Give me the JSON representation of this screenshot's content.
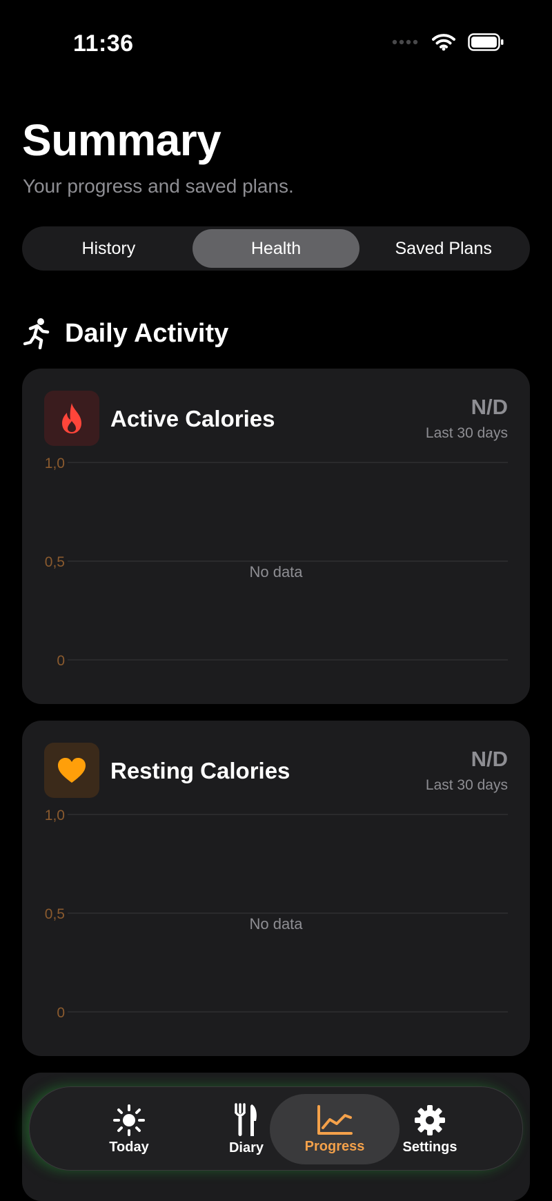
{
  "status": {
    "time": "11:36"
  },
  "header": {
    "title": "Summary",
    "subtitle": "Your progress and saved plans."
  },
  "segments": [
    {
      "label": "History",
      "active": false
    },
    {
      "label": "Health",
      "active": true
    },
    {
      "label": "Saved Plans",
      "active": false
    }
  ],
  "section": {
    "title": "Daily Activity",
    "icon": "running-figure-icon"
  },
  "cards": [
    {
      "title": "Active Calories",
      "value": "N/D",
      "period": "Last 30 days",
      "icon": "flame-icon",
      "icon_color": "#ff453a",
      "chart_data": {
        "type": "line",
        "ylim": [
          0,
          1.0
        ],
        "yticks": [
          "1,0",
          "0,5",
          "0"
        ],
        "series": [],
        "empty_label": "No data"
      }
    },
    {
      "title": "Resting Calories",
      "value": "N/D",
      "period": "Last 30 days",
      "icon": "heart-icon",
      "icon_color": "#ff9f0a",
      "chart_data": {
        "type": "line",
        "ylim": [
          0,
          1.0
        ],
        "yticks": [
          "1,0",
          "0,5",
          "0"
        ],
        "series": [],
        "empty_label": "No data"
      }
    }
  ],
  "tabbar": [
    {
      "label": "Today",
      "icon": "sun-icon",
      "active": false
    },
    {
      "label": "Diary",
      "icon": "fork-knife-icon",
      "active": false
    },
    {
      "label": "Progress",
      "icon": "chart-line-icon",
      "active": true
    },
    {
      "label": "Settings",
      "icon": "gear-icon",
      "active": false
    }
  ],
  "colors": {
    "accent": "#f4a14a",
    "tick": "#8a5a2e",
    "card": "#1c1c1e"
  }
}
